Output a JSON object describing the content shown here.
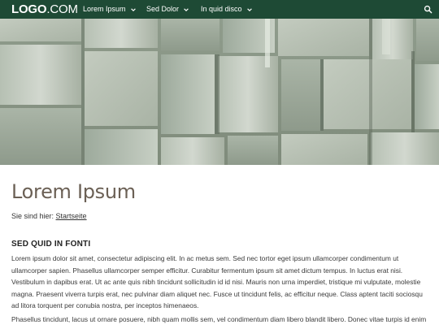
{
  "logo": {
    "bold": "LOGO",
    "light": ".COM"
  },
  "nav": {
    "items": [
      {
        "label": "Lorem Ipsum"
      },
      {
        "label": "Sed Dolor"
      },
      {
        "label": "In quid disco"
      }
    ],
    "search_icon": "search-icon"
  },
  "colors": {
    "navbar": "#1e4a35",
    "title": "#6b6055"
  },
  "page": {
    "title": "Lorem Ipsum",
    "breadcrumb_prefix": "Sie sind hier:",
    "breadcrumb_link": "Startseite",
    "section_heading": "SED QUID IN FONTI",
    "paragraph_1": "Lorem ipsum dolor sit amet, consectetur adipiscing elit. In ac metus sem. Sed nec tortor eget ipsum ullamcorper condimentum ut ullamcorper sapien. Phasellus ullamcorper semper efficitur. Curabitur fermentum ipsum sit amet dictum tempus. In luctus erat nisi. Vestibulum in dapibus erat. Ut ac ante quis nibh tincidunt sollicitudin id id nisi. Mauris non urna imperdiet, tristique mi vulputate, molestie magna. Praesent viverra turpis erat, nec pulvinar diam aliquet nec. Fusce ut tincidunt felis, ac efficitur neque. Class aptent taciti sociosqu ad litora torquent per conubia nostra, per inceptos himenaeos.",
    "paragraph_2": "Phasellus tincidunt, lacus ut ornare posuere, nibh quam mollis sem, vel condimentum diam libero blandit libero. Donec vitae turpis id enim"
  }
}
